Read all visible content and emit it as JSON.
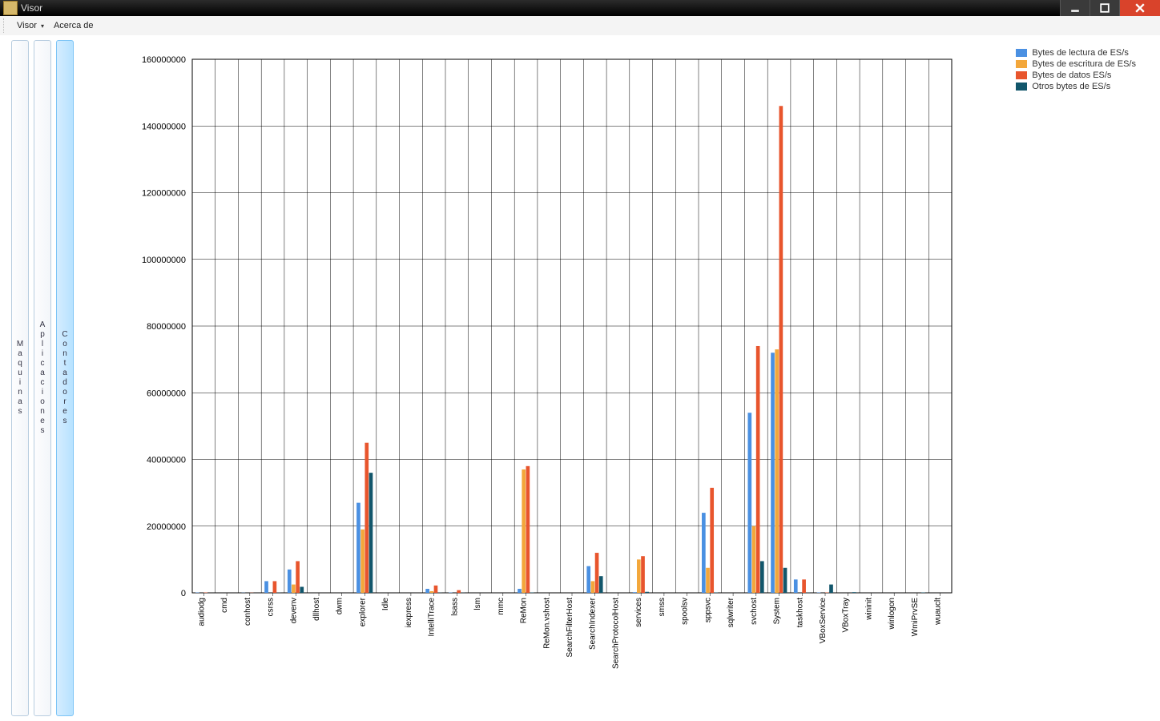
{
  "titlebar": {
    "title": "Visor"
  },
  "menubar": {
    "visor": "Visor",
    "acerca": "Acerca de"
  },
  "tabs": {
    "maquinas": "Maquinas",
    "aplicaciones": "Aplicaciones",
    "contadores": "Contadores"
  },
  "legend": {
    "s0": "Bytes de lectura de ES/s",
    "s1": "Bytes de escritura de ES/s",
    "s2": "Bytes de datos ES/s",
    "s3": "Otros bytes de ES/s"
  },
  "chart_data": {
    "type": "bar",
    "title": "",
    "xlabel": "",
    "ylabel": "",
    "ylim": [
      0,
      160000000
    ],
    "yticks": [
      0,
      20000000,
      40000000,
      60000000,
      80000000,
      100000000,
      120000000,
      140000000,
      160000000
    ],
    "categories": [
      "audiodg",
      "cmd",
      "conhost",
      "csrss",
      "devenv",
      "dllhost",
      "dwm",
      "explorer",
      "Idle",
      "iexpress",
      "IntelliTrace",
      "lsass",
      "lsm",
      "mmc",
      "ReMon",
      "ReMon.vshost",
      "SearchFilterHost",
      "SearchIndexer",
      "SearchProtocolHost",
      "services",
      "smss",
      "spoolsv",
      "sppsvc",
      "sqlwriter",
      "svchost",
      "System",
      "taskhost",
      "VBoxService",
      "VBoxTray",
      "wininit",
      "winlogon",
      "WmiPrvSE",
      "wuauclt"
    ],
    "series": [
      {
        "name": "Bytes de lectura de ES/s",
        "color": "#4a90e2",
        "values": [
          100000,
          0,
          50000,
          3500000,
          7000000,
          0,
          0,
          27000000,
          0,
          0,
          1200000,
          100000,
          0,
          0,
          1200000,
          0,
          0,
          8000000,
          0,
          200000,
          0,
          0,
          24000000,
          0,
          54000000,
          72000000,
          4000000,
          100000,
          0,
          0,
          0,
          0,
          0
        ]
      },
      {
        "name": "Bytes de escritura de ES/s",
        "color": "#f3a73b",
        "values": [
          0,
          0,
          0,
          0,
          2500000,
          0,
          0,
          19000000,
          0,
          0,
          500000,
          0,
          0,
          0,
          37000000,
          0,
          0,
          3500000,
          0,
          10000000,
          0,
          0,
          7500000,
          0,
          20000000,
          73000000,
          0,
          0,
          0,
          0,
          0,
          0,
          0
        ]
      },
      {
        "name": "Bytes de datos ES/s",
        "color": "#e8552d",
        "values": [
          100000,
          0,
          50000,
          3500000,
          9500000,
          0,
          0,
          45000000,
          0,
          0,
          2200000,
          800000,
          0,
          0,
          38000000,
          0,
          0,
          12000000,
          0,
          11000000,
          0,
          0,
          31500000,
          0,
          74000000,
          146000000,
          4000000,
          100000,
          0,
          0,
          0,
          0,
          0
        ]
      },
      {
        "name": "Otros bytes de ES/s",
        "color": "#12566b",
        "values": [
          0,
          0,
          0,
          50000,
          1800000,
          0,
          0,
          36000000,
          0,
          0,
          50000,
          50000,
          0,
          0,
          100000,
          0,
          0,
          5000000,
          0,
          300000,
          0,
          0,
          100000,
          0,
          9500000,
          7500000,
          50000,
          2500000,
          200000,
          0,
          0,
          100000,
          0
        ]
      }
    ]
  }
}
